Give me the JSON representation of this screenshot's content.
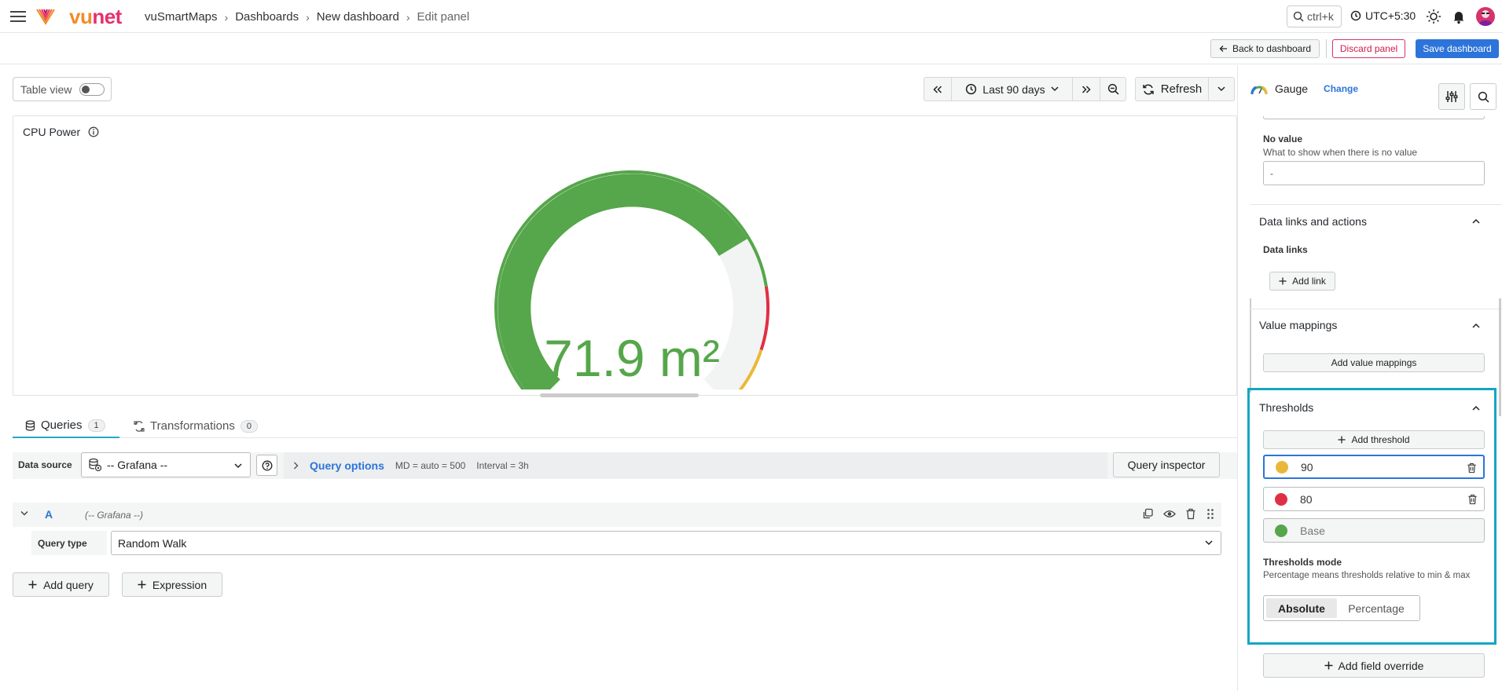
{
  "topbar": {
    "brand_a": "vu",
    "brand_b": "net",
    "breadcrumbs": [
      "vuSmartMaps",
      "Dashboards",
      "New dashboard",
      "Edit panel"
    ],
    "search_shortcut": "ctrl+k",
    "timezone": "UTC+5:30"
  },
  "actions": {
    "back": "Back to dashboard",
    "discard": "Discard panel",
    "save": "Save dashboard"
  },
  "toolbar": {
    "table_view": "Table view",
    "time_range": "Last 90 days",
    "refresh": "Refresh"
  },
  "panel": {
    "title": "CPU Power",
    "gauge": {
      "value": 71.9,
      "display": "71.9 m²",
      "min": 0,
      "max": 100,
      "colors": {
        "green": "#56a64b",
        "red": "#e02f44",
        "yellow": "#eab839",
        "empty": "#f2f3f3"
      }
    }
  },
  "tabs": [
    {
      "label": "Queries",
      "count": "1"
    },
    {
      "label": "Transformations",
      "count": "0"
    }
  ],
  "query_bar": {
    "datasource_label": "Data source",
    "datasource": "-- Grafana --",
    "options_title": "Query options",
    "md": "MD = auto = 500",
    "interval": "Interval = 3h",
    "inspector": "Query inspector"
  },
  "query": {
    "name": "A",
    "datasource": "(-- Grafana --)",
    "type_label": "Query type",
    "type_value": "Random Walk"
  },
  "buttons": {
    "add_query": "Add query",
    "expression": "Expression"
  },
  "sidebar": {
    "vis_name": "Gauge",
    "change": "Change",
    "no_value": {
      "title": "No value",
      "desc": "What to show when there is no value",
      "placeholder": "-"
    },
    "data_links": {
      "title": "Data links and actions",
      "sub": "Data links",
      "add": "Add link"
    },
    "value_mappings": {
      "title": "Value mappings",
      "add": "Add value mappings"
    },
    "thresholds": {
      "title": "Thresholds",
      "add": "Add threshold",
      "items": [
        {
          "value": "90",
          "color": "#eab839"
        },
        {
          "value": "80",
          "color": "#e02f44"
        },
        {
          "value": "Base",
          "color": "#56a64b"
        }
      ],
      "mode_title": "Thresholds mode",
      "mode_desc": "Percentage means thresholds relative to min & max",
      "modes": [
        "Absolute",
        "Percentage"
      ],
      "mode_selected": "Absolute"
    },
    "add_override": "Add field override"
  }
}
